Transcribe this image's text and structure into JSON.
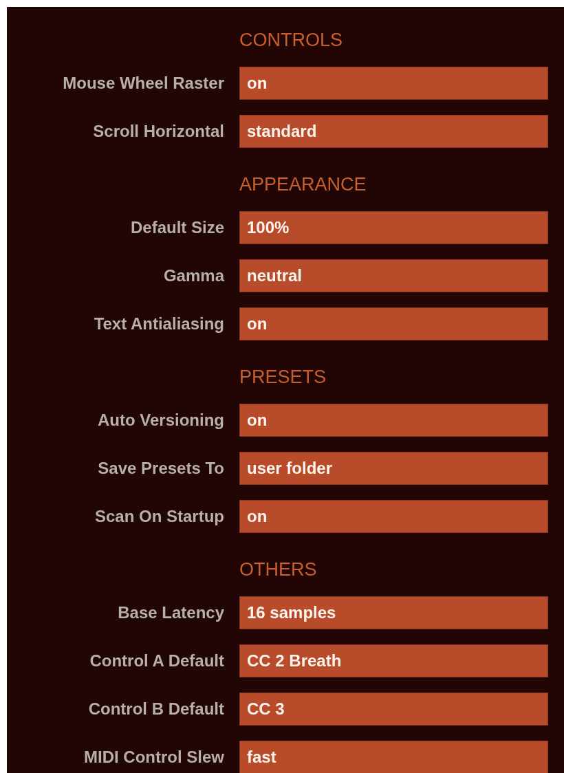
{
  "sections": [
    {
      "heading": "CONTROLS",
      "settings": [
        {
          "label": "Mouse Wheel Raster",
          "value": "on"
        },
        {
          "label": "Scroll Horizontal",
          "value": "standard"
        }
      ]
    },
    {
      "heading": "APPEARANCE",
      "settings": [
        {
          "label": "Default Size",
          "value": "100%"
        },
        {
          "label": "Gamma",
          "value": "neutral"
        },
        {
          "label": "Text Antialiasing",
          "value": "on"
        }
      ]
    },
    {
      "heading": "PRESETS",
      "settings": [
        {
          "label": "Auto Versioning",
          "value": "on"
        },
        {
          "label": "Save Presets To",
          "value": "user folder"
        },
        {
          "label": "Scan On Startup",
          "value": "on"
        }
      ]
    },
    {
      "heading": "OTHERS",
      "settings": [
        {
          "label": "Base Latency",
          "value": "16 samples"
        },
        {
          "label": "Control A Default",
          "value": "CC 2 Breath"
        },
        {
          "label": "Control B Default",
          "value": "CC 3"
        },
        {
          "label": "MIDI Control Slew",
          "value": "fast"
        }
      ]
    }
  ]
}
